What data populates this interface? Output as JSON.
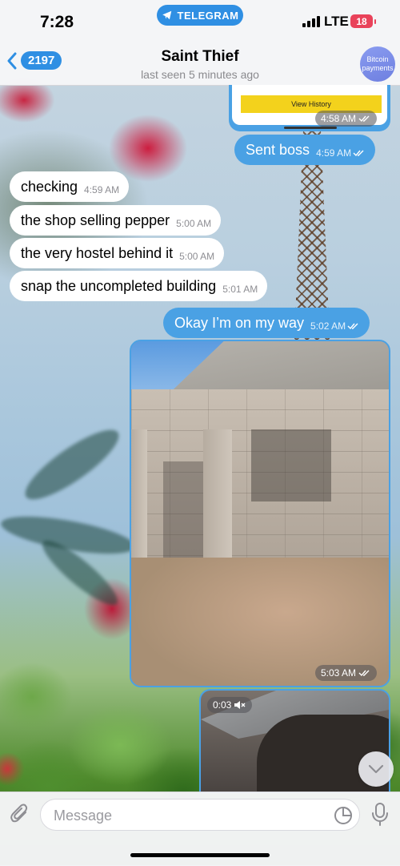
{
  "status_bar": {
    "time": "7:28",
    "app_pill": "TELEGRAM",
    "network": "LTE",
    "battery": "18"
  },
  "header": {
    "back_count": "2197",
    "title": "Saint Thief",
    "subtitle": "last seen 5 minutes ago",
    "avatar_text": "Bitcoin payments"
  },
  "messages": {
    "top_card": {
      "button": "View History",
      "time": "4:58 AM"
    },
    "m1": {
      "text": "Sent boss",
      "time": "4:59 AM"
    },
    "m2": {
      "text": "checking",
      "time": "4:59 AM"
    },
    "m3": {
      "text": "the shop selling pepper",
      "time": "5:00 AM"
    },
    "m4": {
      "text": "the very hostel behind it",
      "time": "5:00 AM"
    },
    "m5": {
      "text": "snap the uncompleted building",
      "time": "5:01 AM"
    },
    "m6": {
      "text": "Okay I’m on my way",
      "time": "5:02 AM"
    },
    "photo": {
      "time": "5:03 AM"
    },
    "video": {
      "duration": "0:03"
    }
  },
  "input": {
    "placeholder": "Message"
  },
  "colors": {
    "accent": "#2f8fe3",
    "outgoing_bubble": "#4aa1e4",
    "incoming_bubble": "#ffffff",
    "battery_low": "#e9425a"
  },
  "icons": [
    "telegram-plane-icon",
    "signal-icon",
    "chevron-left-icon",
    "double-check-icon",
    "mute-icon",
    "chevron-down-icon",
    "paperclip-icon",
    "sticker-icon",
    "microphone-icon"
  ]
}
